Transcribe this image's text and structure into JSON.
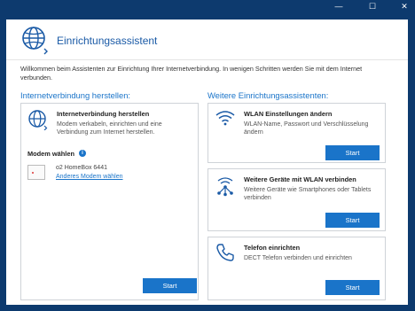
{
  "window": {
    "minimize": "—",
    "maximize": "☐",
    "close": "✕"
  },
  "header": {
    "title": "Einrichtungsassistent"
  },
  "intro": "Willkommen beim Assistenten zur Einrichtung Ihrer Internetverbindung. In wenigen Schritten werden Sie mit dem Internet verbunden.",
  "left": {
    "heading": "Internetverbindung herstellen:",
    "card": {
      "title": "Internetverbindung herstellen",
      "description": "Modem verkabeln, einrichten und eine Verbindung zum Internet herstellen.",
      "modem_label": "Modem wählen",
      "info": "i",
      "modem_name": "o2 HomeBox 6441",
      "change_link": "Anderes Modem wählen",
      "start": "Start"
    }
  },
  "right": {
    "heading": "Weitere Einrichtungsassistenten:",
    "cards": [
      {
        "icon": "wifi-icon",
        "title": "WLAN Einstellungen ändern",
        "description": "WLAN-Name, Passwort und Verschlüsselung ändern",
        "start": "Start"
      },
      {
        "icon": "devices-network-icon",
        "title": "Weitere Geräte mit WLAN verbinden",
        "description": "Weitere Geräte wie Smartphones oder Tablets verbinden",
        "start": "Start"
      },
      {
        "icon": "phone-icon",
        "title": "Telefon einrichten",
        "description": "DECT Telefon verbinden und einrichten",
        "start": "Start"
      }
    ]
  },
  "colors": {
    "accent": "#1a74c9",
    "titlebar": "#0d3a6e"
  }
}
